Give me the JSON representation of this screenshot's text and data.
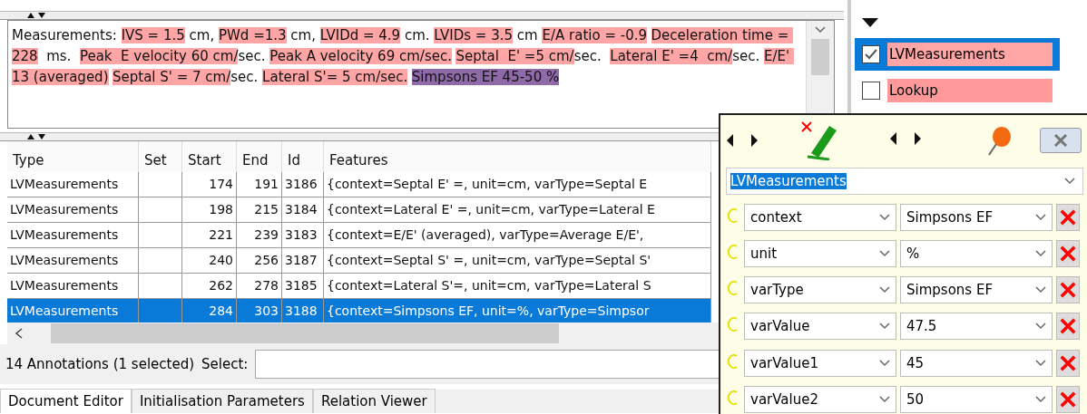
{
  "document": {
    "segments": [
      {
        "text": "Measurements: "
      },
      {
        "text": "IVS = 1.5",
        "color": "#ffa5a5"
      },
      {
        "text": " cm, "
      },
      {
        "text": "PWd =1.3",
        "color": "#ffa5a5"
      },
      {
        "text": " cm, "
      },
      {
        "text": "LVIDd = 4.9",
        "color": "#ffa5a5"
      },
      {
        "text": " cm. "
      },
      {
        "text": "LVIDs = 3.5",
        "color": "#ffa5a5"
      },
      {
        "text": " cm "
      },
      {
        "text": "E/A ratio = -0.9",
        "color": "#ffa5a5"
      },
      {
        "text": "Deceleration time = 228",
        "color": "#ffa5a5"
      },
      {
        "text": "  ms.  "
      },
      {
        "text": "Peak  E velocity 60 cm/",
        "color": "#ffa5a5"
      },
      {
        "text": "sec. "
      },
      {
        "text": "Peak A velocity 69 cm/sec.",
        "color": "#ffa5a5"
      },
      {
        "text": "Septal  E' =5 cm/",
        "color": "#ffa5a5"
      },
      {
        "text": "sec.  "
      },
      {
        "text": "Lateral E' =4  cm/",
        "color": "#ffa5a5"
      },
      {
        "text": "sec. "
      },
      {
        "text": "E/E' 13 (averaged)",
        "color": "#ffa5a5"
      },
      {
        "text": "Septal S' = 7 cm/",
        "color": "#ffa5a5"
      },
      {
        "text": "sec. "
      },
      {
        "text": "Lateral S'= 5 cm/sec.",
        "color": "#ffa5a5"
      },
      {
        "text": "Simpsons EF 45-50 %",
        "color": "#8f6aa8"
      }
    ]
  },
  "table": {
    "columns": [
      "Type",
      "Set",
      "Start",
      "End",
      "Id",
      "Features"
    ],
    "rows": [
      {
        "cells": [
          "LVMeasurements",
          "",
          "174",
          "191",
          "3186",
          "{context=Septal  E' =, unit=cm, varType=Septal E"
        ],
        "selected": false
      },
      {
        "cells": [
          "LVMeasurements",
          "",
          "198",
          "215",
          "3184",
          "{context=Lateral E' =, unit=cm, varType=Lateral E"
        ],
        "selected": false
      },
      {
        "cells": [
          "LVMeasurements",
          "",
          "221",
          "239",
          "3183",
          "{context=E/E' (averaged), varType=Average E/E',"
        ],
        "selected": false
      },
      {
        "cells": [
          "LVMeasurements",
          "",
          "240",
          "256",
          "3187",
          "{context=Septal S' =, unit=cm, varType=Septal S'"
        ],
        "selected": false
      },
      {
        "cells": [
          "LVMeasurements",
          "",
          "262",
          "278",
          "3185",
          "{context=Lateral S'=, unit=cm, varType=Lateral S"
        ],
        "selected": false
      },
      {
        "cells": [
          "LVMeasurements",
          "",
          "284",
          "303",
          "3188",
          "{context=Simpsons EF, unit=%, varType=Simpsor"
        ],
        "selected": true
      }
    ]
  },
  "status": {
    "count": "14 Annotations (1 selected)",
    "select_label": "Select:"
  },
  "tabs": [
    {
      "label": "Document Editor",
      "selected": true
    },
    {
      "label": "Initialisation Parameters",
      "selected": false
    },
    {
      "label": "Relation Viewer",
      "selected": false
    }
  ],
  "annotation_sets": [
    {
      "label": "LVMeasurements",
      "checked": true,
      "selected": true,
      "color": "#ffa5a5"
    },
    {
      "label": "Lookup",
      "checked": false,
      "selected": false,
      "color": "#ff9999"
    }
  ],
  "editor": {
    "type": "LVMeasurements",
    "features": [
      {
        "name": "context",
        "value": "Simpsons EF"
      },
      {
        "name": "unit",
        "value": "%"
      },
      {
        "name": "varType",
        "value": "Simpsons EF"
      },
      {
        "name": "varValue",
        "value": "47.5"
      },
      {
        "name": "varValue1",
        "value": "45"
      },
      {
        "name": "varValue2",
        "value": "50"
      }
    ]
  }
}
